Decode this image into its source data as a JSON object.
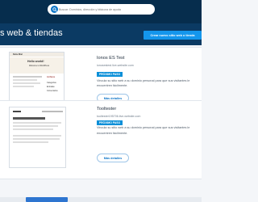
{
  "colors": {
    "topbar": "#062d4d",
    "hero": "#0b3a63",
    "accent": "#1496ec",
    "badge": "#0a8fd8",
    "link": "#0b74c7"
  },
  "search": {
    "icon": "search-icon",
    "placeholder": "Buscar: Dominios, dirección y bitácora de ayuda"
  },
  "header": {
    "title": "s web & tiendas",
    "create_button": "Crear nuevo sitio web o tienda"
  },
  "sites": [
    {
      "name": "Ionos ES Test",
      "url": "ionosestest.live-website.com",
      "badge": "PRÓXIMO PASO",
      "description": "Vincula su sitio web a su dominio personal para que sus visitantes le encuentren fácilmente.",
      "button": "Más detalles",
      "preview": {
        "brand": "Dulce Miel",
        "heading": "Hello world!",
        "line": "Welcome to WordPress",
        "side_title": "Archivos",
        "side_items": [
          "Categorías",
          "Entradas",
          "Comentarios"
        ]
      }
    },
    {
      "name": "Tooltester",
      "url": "tooltester195706.live-website.com",
      "badge": "PRÓXIMO PASO",
      "description": "Vincula su sitio web a su dominio personal para que sus visitantes le encuentren fácilmente.",
      "button": "Más detalles"
    }
  ]
}
